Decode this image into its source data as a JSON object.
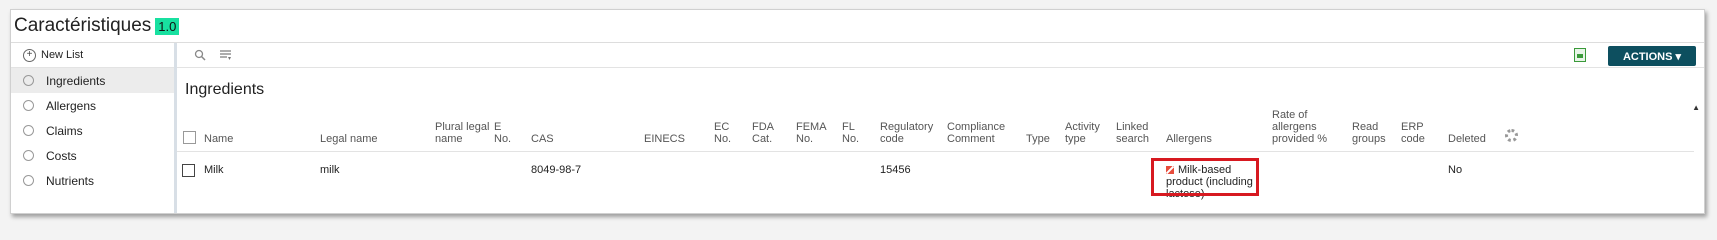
{
  "app": {
    "title": "Caractéristiques",
    "version": "1.0"
  },
  "sidebar": {
    "new_list": "New List",
    "items": [
      {
        "label": "Ingredients"
      },
      {
        "label": "Allergens"
      },
      {
        "label": "Claims"
      },
      {
        "label": "Costs"
      },
      {
        "label": "Nutrients"
      }
    ]
  },
  "toolbar": {
    "actions_label": "ACTIONS ▾"
  },
  "section": {
    "title": "Ingredients"
  },
  "table": {
    "headers": {
      "name": "Name",
      "legal_name": "Legal name",
      "plural_legal_name": "Plural legal name",
      "e_no": "E No.",
      "cas": "CAS",
      "einecs": "EINECS",
      "ec_no": "EC No.",
      "fda_cat": "FDA Cat.",
      "fema_no": "FEMA No.",
      "fl_no": "FL No.",
      "regulatory_code": "Regulatory code",
      "compliance_comment": "Compliance Comment",
      "type": "Type",
      "activity_type": "Activity type",
      "linked_search": "Linked search",
      "allergens": "Allergens",
      "rate_allergens": "Rate of allergens provided %",
      "read_groups": "Read groups",
      "erp_code": "ERP code",
      "deleted": "Deleted"
    },
    "rows": [
      {
        "name": "Milk",
        "legal_name": "milk",
        "cas": "8049-98-7",
        "regulatory_code": "15456",
        "allergen": "Milk-based product (including lactose)",
        "deleted": "No"
      }
    ]
  }
}
